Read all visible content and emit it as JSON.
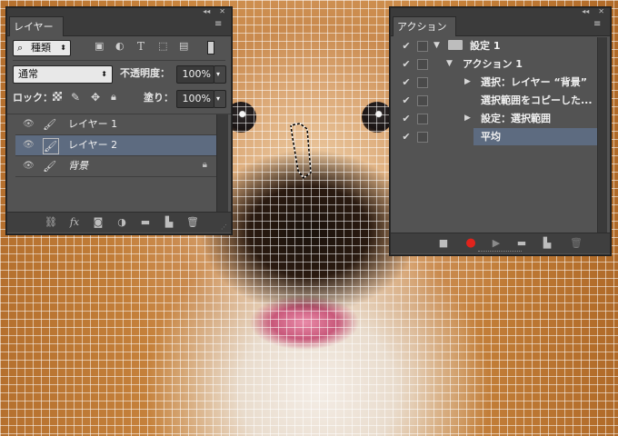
{
  "layers_panel": {
    "tab_label": "レイヤー",
    "collapse_glyph": "◂◂",
    "close_glyph": "✕",
    "menu_glyph": "≡",
    "filter_label": "種類",
    "blend_mode": "通常",
    "opacity_label": "不透明度：",
    "opacity_value": "100%",
    "lock_label": "ロック：",
    "fill_label": "塗り：",
    "fill_value": "100%",
    "layers": [
      {
        "name": "レイヤー 1",
        "selected": false,
        "locked": false
      },
      {
        "name": "レイヤー 2",
        "selected": true,
        "locked": false
      },
      {
        "name": "背景",
        "selected": false,
        "locked": true
      }
    ]
  },
  "actions_panel": {
    "tab_label": "アクション",
    "collapse_glyph": "◂◂",
    "close_glyph": "✕",
    "menu_glyph": "≡",
    "items": [
      {
        "label": "設定 1",
        "level": 0,
        "expanded": true,
        "folder": true,
        "selected": false
      },
      {
        "label": "アクション 1",
        "level": 1,
        "expanded": true,
        "folder": false,
        "selected": false
      },
      {
        "label": "選択：レイヤー “背景”",
        "level": 2,
        "expanded": false,
        "has_arrow": true,
        "selected": false
      },
      {
        "label": "選択範囲をコピーした...",
        "level": 2,
        "expanded": false,
        "has_arrow": false,
        "selected": false
      },
      {
        "label": "設定：選択範囲",
        "level": 2,
        "expanded": false,
        "has_arrow": true,
        "selected": false
      },
      {
        "label": "平均",
        "level": 2,
        "expanded": false,
        "has_arrow": false,
        "selected": true
      }
    ]
  },
  "colors": {
    "panel_bg": "#535353",
    "panel_dark": "#3b3b3b",
    "selection_blue": "#5d6b80",
    "record_red": "#e0231c"
  }
}
